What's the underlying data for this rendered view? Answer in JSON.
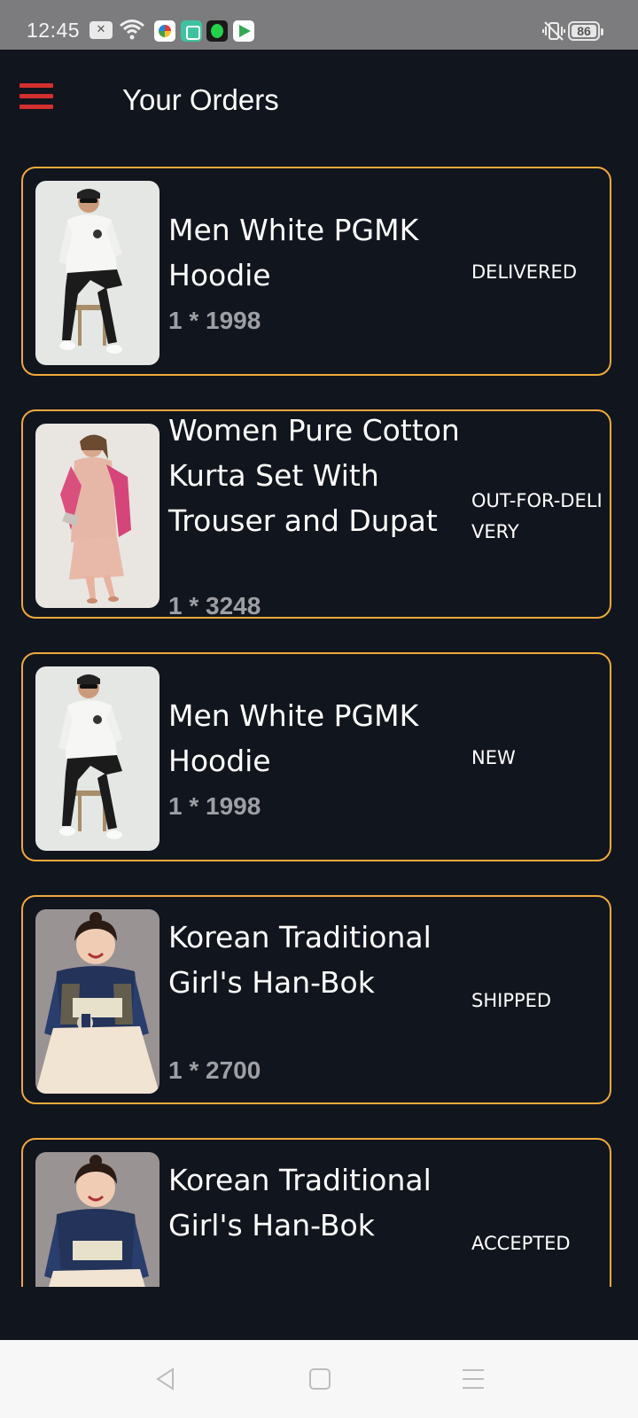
{
  "status_bar": {
    "time": "12:45",
    "battery": "86",
    "icons": [
      "close-notification-icon",
      "wifi-icon",
      "app-icon",
      "app-icon",
      "app-icon",
      "play-store-icon",
      "vibrate-icon",
      "battery-icon"
    ]
  },
  "header": {
    "title": "Your Orders",
    "menu_icon": "hamburger-menu-icon"
  },
  "orders": [
    {
      "name": "Men White PGMK Hoodie",
      "qty_price": "1 * 1998",
      "status": "DELIVERED"
    },
    {
      "name": "Women Pure Cotton Kurta Set With Trouser and Dupat",
      "qty_price": "1 * 3248",
      "status": "OUT-FOR-DELIVERY"
    },
    {
      "name": "Men White PGMK Hoodie",
      "qty_price": "1 * 1998",
      "status": "NEW"
    },
    {
      "name": "Korean Traditional Girl's Han-Bok",
      "qty_price": "1 * 2700",
      "status": "SHIPPED"
    },
    {
      "name": "Korean Traditional Girl's Han-Bok",
      "qty_price": "",
      "status": "ACCEPTED"
    }
  ],
  "colors": {
    "background": "#11151d",
    "card_border": "#f0a93b",
    "menu_icon": "#d32f2f",
    "price_text": "#9e9fa4"
  },
  "nav": {
    "icons": [
      "back-icon",
      "home-icon",
      "recents-menu-icon"
    ]
  }
}
